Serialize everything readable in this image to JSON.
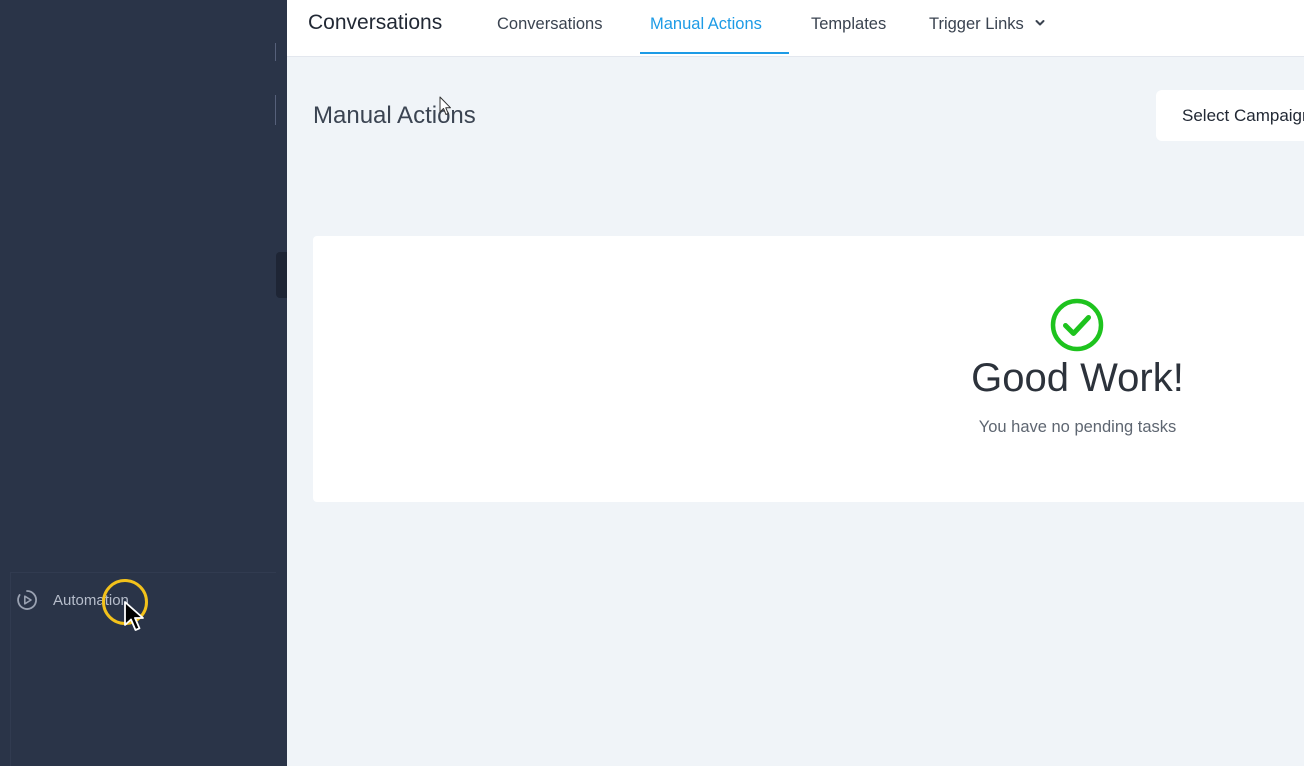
{
  "header": {
    "app_title": "Conversations",
    "tabs": [
      {
        "label": "Conversations",
        "active": false
      },
      {
        "label": "Manual Actions",
        "active": true
      },
      {
        "label": "Templates",
        "active": false
      },
      {
        "label": "Trigger Links",
        "active": false,
        "has_dropdown": true
      }
    ]
  },
  "sidebar": {
    "items": [
      {
        "label": "Automation",
        "icon": "automation-play-icon"
      }
    ]
  },
  "main": {
    "page_title": "Manual Actions",
    "select_campaign": "Select Campaign",
    "empty_state": {
      "icon": "check-circle-icon",
      "title": "Good Work!",
      "subtitle": "You have no pending tasks"
    }
  },
  "colors": {
    "sidebar_bg": "#2a3448",
    "accent": "#1d9be6",
    "success": "#1ec31e",
    "cursor_ring": "#f3c21b"
  }
}
